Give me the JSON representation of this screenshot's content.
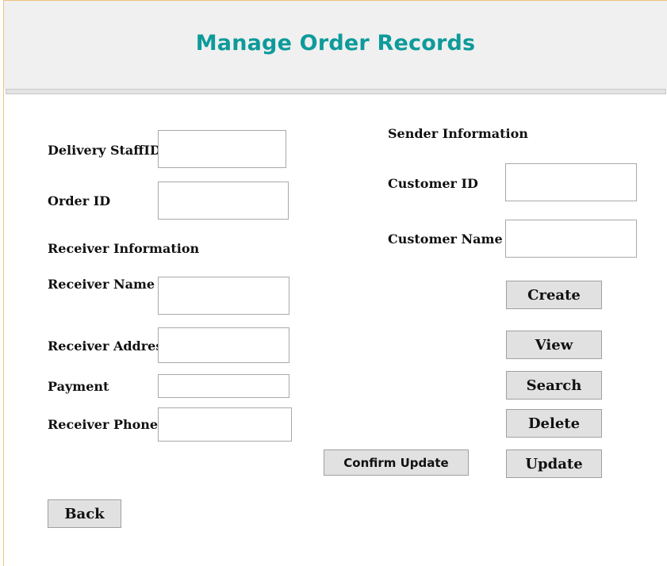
{
  "header": {
    "title": "Manage Order Records"
  },
  "form": {
    "delivery_staff_id": {
      "label": "Delivery StaffID",
      "value": ""
    },
    "order_id": {
      "label": "Order ID",
      "value": ""
    },
    "receiver_section": "Receiver Information",
    "receiver_name": {
      "label": "Receiver Name",
      "value": ""
    },
    "receiver_address": {
      "label": "Receiver Address",
      "value": ""
    },
    "payment": {
      "label": "Payment",
      "value": ""
    },
    "receiver_phone": {
      "label": "Receiver Phone",
      "value": ""
    },
    "sender_section": "Sender Information",
    "customer_id": {
      "label": "Customer ID",
      "value": ""
    },
    "customer_name": {
      "label": "Customer Name",
      "value": ""
    }
  },
  "buttons": {
    "create": "Create",
    "view": "View",
    "search": "Search",
    "delete": "Delete",
    "update": "Update",
    "confirm_update": "Confirm Update",
    "back": "Back"
  },
  "colors": {
    "title": "#0e9a9a",
    "header_bg": "#f0f0f0",
    "button_bg": "#e1e1e1",
    "frame_border": "#f0c27a"
  }
}
